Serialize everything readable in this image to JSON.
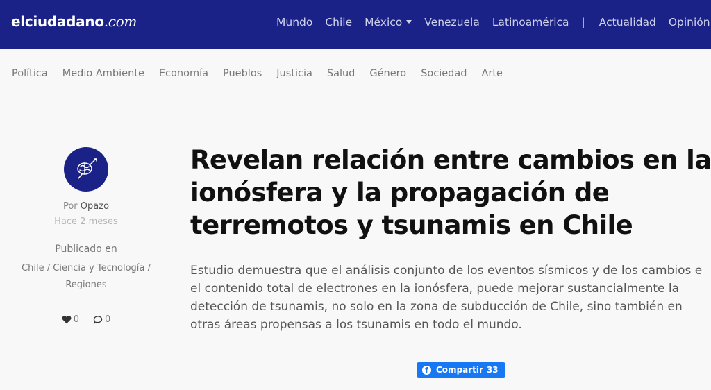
{
  "brand": {
    "name_bold": "elciudadano",
    "name_suffix": ".com"
  },
  "top_nav": {
    "items": [
      "Mundo",
      "Chile",
      "México",
      "Venezuela",
      "Latinoamérica"
    ],
    "separator": "|",
    "items_after": [
      "Actualidad",
      "Opinión"
    ]
  },
  "category_nav": [
    "Política",
    "Medio Ambiente",
    "Economía",
    "Pueblos",
    "Justicia",
    "Salud",
    "Género",
    "Sociedad",
    "Arte"
  ],
  "author": {
    "by_prefix": "Por",
    "name": "Opazo",
    "time_ago": "Hace 2 meses",
    "published_in_label": "Publicado en",
    "categories": [
      "Chile",
      "Ciencia y Tecnología",
      "Regiones"
    ],
    "category_sep": " / ",
    "likes": "0",
    "comments": "0"
  },
  "article": {
    "title_lines": [
      "Revelan relación entre cambios en la",
      "ionósfera y la propagación de",
      "terremotos y tsunamis en Chile"
    ],
    "lead_lines": [
      "Estudio demuestra que el análisis conjunto de los eventos sísmicos y de los cambios e",
      "el contenido total de electrones en la ionósfera, puede mejorar sustancialmente la",
      "detección de tsunamis, no solo en la zona de subducción de Chile, sino también en",
      "otras áreas propensas a los tsunamis en todo el mundo."
    ]
  },
  "share": {
    "label": "Compartir",
    "count": "33",
    "icon": "facebook-icon"
  },
  "colors": {
    "nav_bg": "#1b2287",
    "facebook": "#1877f2",
    "background": "#f8f8f8"
  }
}
